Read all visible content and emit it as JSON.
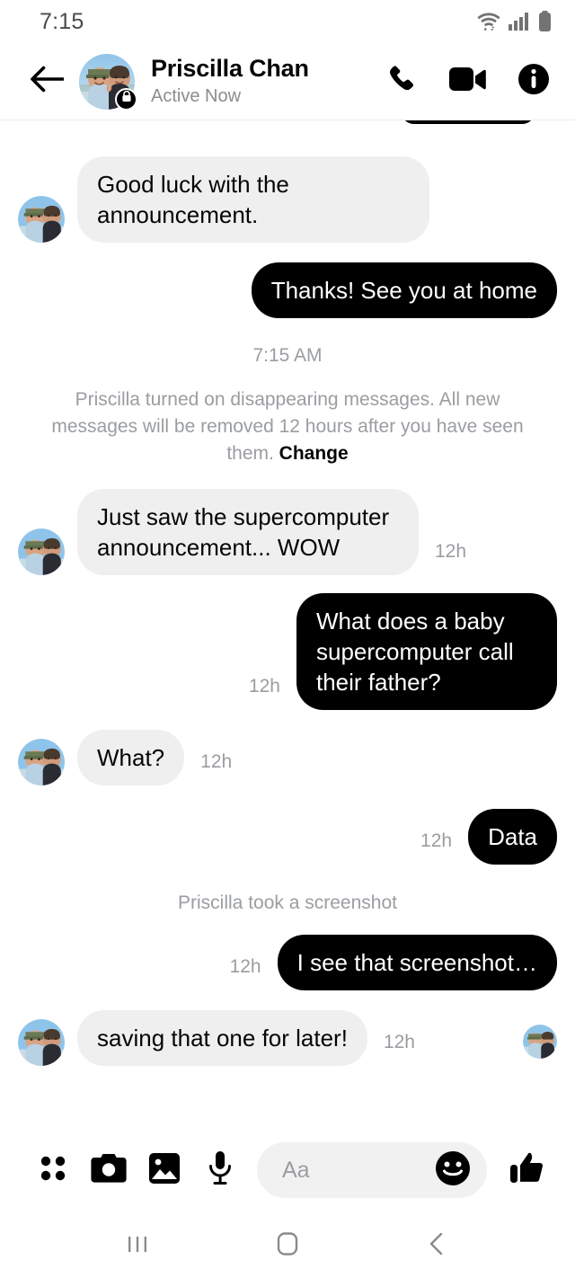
{
  "status_bar": {
    "time": "7:15",
    "icons": [
      "wifi-icon",
      "cellular-signal-icon",
      "battery-icon"
    ]
  },
  "header": {
    "back_icon": "back-arrow-icon",
    "contact_name": "Priscilla Chan",
    "presence": "Active Now",
    "avatar_badge": "lock-icon",
    "actions": [
      {
        "name": "voice-call-button",
        "icon": "phone-icon"
      },
      {
        "name": "video-call-button",
        "icon": "video-camera-icon"
      },
      {
        "name": "conversation-info-button",
        "icon": "info-icon"
      }
    ]
  },
  "thread": {
    "time_divider": "7:15 AM",
    "system_notice": {
      "text": "Priscilla turned on disappearing messages. All new messages will be removed 12 hours after you have seen them. ",
      "action_label": "Change"
    },
    "screenshot_notice": "Priscilla took a screenshot",
    "messages": [
      {
        "id": "m1",
        "side": "in",
        "text": "Good luck with the announcement.",
        "timestamp": "",
        "avatar": true
      },
      {
        "id": "m2",
        "side": "out",
        "text": "Thanks! See you at home",
        "timestamp": "",
        "avatar": false
      },
      {
        "id": "m3",
        "side": "in",
        "text": "Just saw the supercomputer announcement... WOW",
        "timestamp": "12h",
        "avatar": true
      },
      {
        "id": "m4",
        "side": "out",
        "text": "What does a baby supercomputer call their father?",
        "timestamp": "12h",
        "avatar": false
      },
      {
        "id": "m5",
        "side": "in",
        "text": "What?",
        "timestamp": "12h",
        "avatar": true
      },
      {
        "id": "m6",
        "side": "out",
        "text": "Data",
        "timestamp": "12h",
        "avatar": false
      },
      {
        "id": "m7",
        "side": "out",
        "text": "I see that screenshot…",
        "timestamp": "12h",
        "avatar": false
      },
      {
        "id": "m8",
        "side": "in",
        "text": "saving that one for later!",
        "timestamp": "12h",
        "avatar": true
      }
    ]
  },
  "composer": {
    "placeholder": "Aa",
    "value": "",
    "left_actions": [
      {
        "name": "more-apps-button",
        "icon": "four-dots-icon"
      },
      {
        "name": "camera-button",
        "icon": "camera-icon"
      },
      {
        "name": "gallery-button",
        "icon": "image-icon"
      },
      {
        "name": "voice-record-button",
        "icon": "microphone-icon"
      }
    ],
    "emoji_icon": "smiley-face-icon",
    "like_icon": "thumbs-up-icon"
  },
  "navbar": {
    "recents_icon": "recents-bars-icon",
    "home_icon": "home-square-icon",
    "back_icon": "back-chevron-icon"
  },
  "colors": {
    "outgoing_bubble": "#000000",
    "incoming_bubble": "#efeff0",
    "outgoing_text": "#ffffff",
    "incoming_text": "#050505",
    "muted_text": "#9a9da1",
    "composer_pill": "#f1f1f2"
  }
}
